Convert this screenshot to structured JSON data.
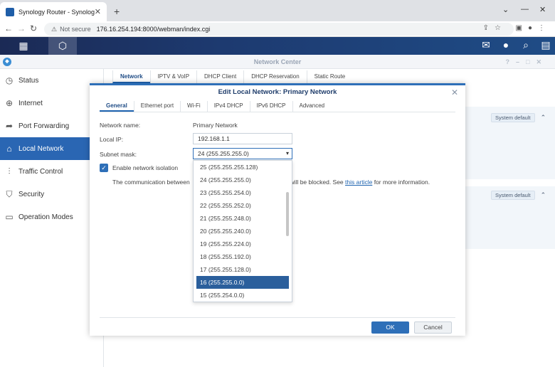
{
  "browser": {
    "tab_title": "Synology Router - SynologyRout",
    "not_secure": "Not secure",
    "url": "176.16.254.194:8000/webman/index.cgi"
  },
  "app": {
    "title": "Network Center",
    "main_tabs": [
      {
        "label": "Network",
        "active": true
      },
      {
        "label": "IPTV & VoIP"
      },
      {
        "label": "DHCP Client"
      },
      {
        "label": "DHCP Reservation"
      },
      {
        "label": "Static Route"
      }
    ],
    "badges": [
      "System default",
      "System default"
    ]
  },
  "sidebar": {
    "items": [
      {
        "label": "Status",
        "icon": "status-icon"
      },
      {
        "label": "Internet",
        "icon": "globe-icon"
      },
      {
        "label": "Port Forwarding",
        "icon": "forward-icon"
      },
      {
        "label": "Local Network",
        "icon": "home-network-icon",
        "active": true
      },
      {
        "label": "Traffic Control",
        "icon": "sliders-icon"
      },
      {
        "label": "Security",
        "icon": "shield-icon"
      },
      {
        "label": "Operation Modes",
        "icon": "router-icon"
      }
    ]
  },
  "dialog": {
    "title": "Edit Local Network: Primary Network",
    "tabs": [
      "General",
      "Ethernet port",
      "Wi-Fi",
      "IPv4 DHCP",
      "IPv6 DHCP",
      "Advanced"
    ],
    "network_name_label": "Network name:",
    "network_name_value": "Primary Network",
    "local_ip_label": "Local IP:",
    "local_ip_value": "192.168.1.1",
    "subnet_mask_label": "Subnet mask:",
    "subnet_mask_value": "24 (255.255.255.0)",
    "isolation_label": "Enable network isolation",
    "isolation_checked": true,
    "desc_start": "The communication between",
    "desc_mid": "ks will be blocked. See",
    "desc_link": "this article",
    "desc_end": "for more information.",
    "dropdown_options": [
      "25 (255.255.255.128)",
      "24 (255.255.255.0)",
      "23 (255.255.254.0)",
      "22 (255.255.252.0)",
      "21 (255.255.248.0)",
      "20 (255.255.240.0)",
      "19 (255.255.224.0)",
      "18 (255.255.192.0)",
      "17 (255.255.128.0)",
      "16 (255.255.0.0)",
      "15 (255.254.0.0)"
    ],
    "dropdown_selected_index": 9,
    "ok_label": "OK",
    "cancel_label": "Cancel"
  },
  "colors": {
    "accent": "#2e6fb8",
    "sidebar_active": "#2a66b3",
    "dropdown_selected": "#2b5f9c"
  }
}
